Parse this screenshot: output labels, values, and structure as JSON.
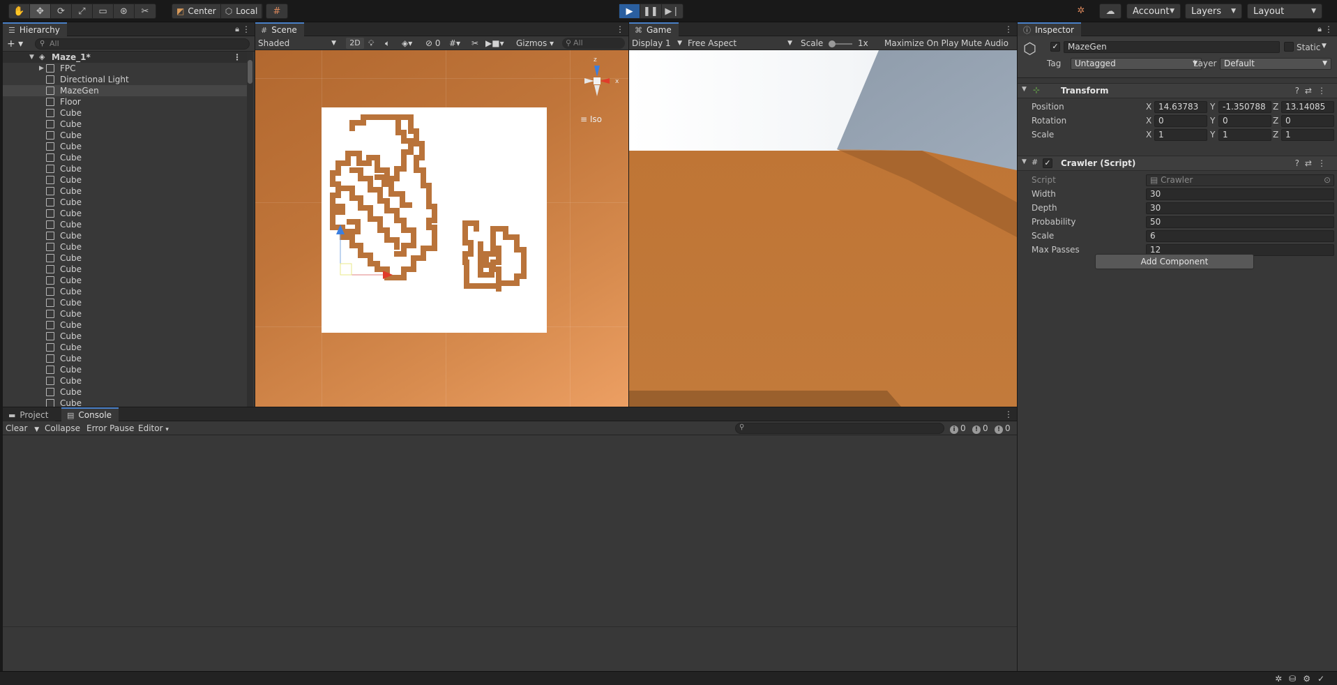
{
  "toolbar": {
    "tools": [
      "✋",
      "✥",
      "⟳",
      "⤢",
      "▭",
      "⊛",
      "✂"
    ],
    "pivot_label": "Center",
    "space_label": "Local",
    "account_label": "Account",
    "layers_label": "Layers",
    "layout_label": "Layout"
  },
  "hierarchy": {
    "tab": "Hierarchy",
    "search_placeholder": "All",
    "scene_name": "Maze_1*",
    "items": [
      {
        "label": "FPC",
        "foldable": true
      },
      {
        "label": "Directional Light"
      },
      {
        "label": "MazeGen",
        "selected": true
      },
      {
        "label": "Floor"
      },
      {
        "label": "Cube"
      },
      {
        "label": "Cube"
      },
      {
        "label": "Cube"
      },
      {
        "label": "Cube"
      },
      {
        "label": "Cube"
      },
      {
        "label": "Cube"
      },
      {
        "label": "Cube"
      },
      {
        "label": "Cube"
      },
      {
        "label": "Cube"
      },
      {
        "label": "Cube"
      },
      {
        "label": "Cube"
      },
      {
        "label": "Cube"
      },
      {
        "label": "Cube"
      },
      {
        "label": "Cube"
      },
      {
        "label": "Cube"
      },
      {
        "label": "Cube"
      },
      {
        "label": "Cube"
      },
      {
        "label": "Cube"
      },
      {
        "label": "Cube"
      },
      {
        "label": "Cube"
      },
      {
        "label": "Cube"
      },
      {
        "label": "Cube"
      },
      {
        "label": "Cube"
      },
      {
        "label": "Cube"
      },
      {
        "label": "Cube"
      },
      {
        "label": "Cube"
      },
      {
        "label": "Cube"
      }
    ]
  },
  "scene": {
    "tab": "Scene",
    "shading": "Shaded",
    "mode_2d": "2D",
    "hidden_count": "0",
    "gizmos_label": "Gizmos",
    "search_placeholder": "All",
    "projection": "Iso",
    "axis_z": "z",
    "axis_x": "x"
  },
  "game": {
    "tab": "Game",
    "display": "Display 1",
    "aspect": "Free Aspect",
    "scale_label": "Scale",
    "scale_value": "1x",
    "maximize_label": "Maximize On Play",
    "mute_label": "Mute Audio"
  },
  "inspector": {
    "tab": "Inspector",
    "object_name": "MazeGen",
    "static_label": "Static",
    "tag_label": "Tag",
    "tag_value": "Untagged",
    "layer_label": "Layer",
    "layer_value": "Default",
    "transform": {
      "title": "Transform",
      "position_label": "Position",
      "rotation_label": "Rotation",
      "scale_label": "Scale",
      "position": {
        "x": "14.63783",
        "y": "-1.350788",
        "z": "13.14085"
      },
      "rotation": {
        "x": "0",
        "y": "0",
        "z": "0"
      },
      "scale": {
        "x": "1",
        "y": "1",
        "z": "1"
      }
    },
    "crawler": {
      "title": "Crawler (Script)",
      "script_label": "Script",
      "script_value": "Crawler",
      "fields": [
        {
          "label": "Width",
          "value": "30"
        },
        {
          "label": "Depth",
          "value": "30"
        },
        {
          "label": "Probability",
          "value": "50"
        },
        {
          "label": "Scale",
          "value": "6"
        },
        {
          "label": "Max Passes",
          "value": "12"
        }
      ]
    },
    "add_component": "Add Component"
  },
  "console": {
    "project_tab": "Project",
    "console_tab": "Console",
    "clear_label": "Clear",
    "collapse_label": "Collapse",
    "error_pause_label": "Error Pause",
    "editor_label": "Editor",
    "log_count": "0",
    "warning_count": "0",
    "error_count": "0"
  },
  "colors": {
    "accent": "#4a80c8",
    "play_active": "#2a5fa0",
    "maze_wall": "#b9733a",
    "floor": "#ffffff",
    "terrain": "#c37939"
  }
}
